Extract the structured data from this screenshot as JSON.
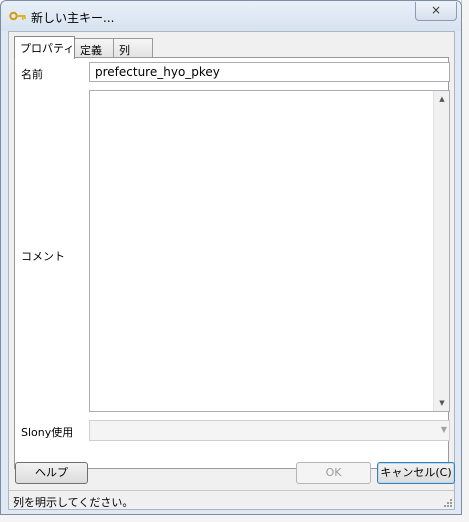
{
  "window": {
    "title": "新しい主キー...",
    "close_glyph": "×"
  },
  "tabs": [
    {
      "label": "プロパティ",
      "active": true
    },
    {
      "label": "定義",
      "active": false
    },
    {
      "label": "列",
      "active": false
    }
  ],
  "form": {
    "name_label": "名前",
    "name_value": "prefecture_hyo_pkey",
    "comment_label": "コメント",
    "comment_value": "",
    "slony_label": "Slony使用",
    "slony_value": ""
  },
  "buttons": {
    "help": "ヘルプ",
    "ok": "OK",
    "cancel": "キャンセル(C)"
  },
  "status": {
    "text": "列を明示してください。"
  },
  "icons": {
    "title_icon": "key-icon",
    "close_icon": "close-icon"
  },
  "colors": {
    "titlebar": "#dfe8f3",
    "window_bg": "#f0f0f0",
    "key_icon": "#e0b020"
  }
}
